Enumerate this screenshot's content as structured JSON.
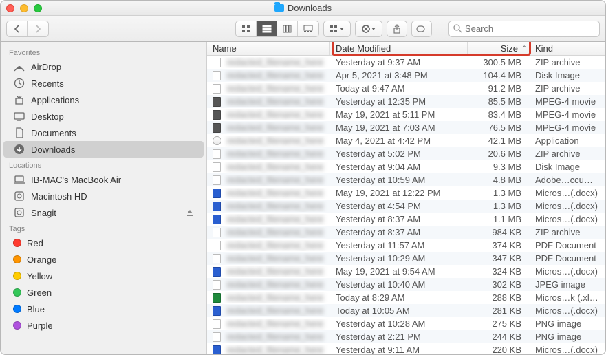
{
  "window": {
    "title": "Downloads"
  },
  "toolbar": {
    "search_placeholder": "Search"
  },
  "sidebar": {
    "sections": [
      {
        "header": "Favorites",
        "items": [
          {
            "icon": "airdrop",
            "label": "AirDrop"
          },
          {
            "icon": "clock",
            "label": "Recents"
          },
          {
            "icon": "apps",
            "label": "Applications"
          },
          {
            "icon": "desktop",
            "label": "Desktop"
          },
          {
            "icon": "doc",
            "label": "Documents"
          },
          {
            "icon": "download",
            "label": "Downloads",
            "selected": true
          }
        ]
      },
      {
        "header": "Locations",
        "items": [
          {
            "icon": "laptop",
            "label": "IB-MAC's MacBook Air"
          },
          {
            "icon": "disk",
            "label": "Macintosh HD"
          },
          {
            "icon": "disk",
            "label": "Snagit",
            "eject": true
          }
        ]
      },
      {
        "header": "Tags",
        "items": [
          {
            "icon": "tag",
            "color": "#ff3b30",
            "label": "Red"
          },
          {
            "icon": "tag",
            "color": "#ff9500",
            "label": "Orange"
          },
          {
            "icon": "tag",
            "color": "#ffcc00",
            "label": "Yellow"
          },
          {
            "icon": "tag",
            "color": "#34c759",
            "label": "Green"
          },
          {
            "icon": "tag",
            "color": "#007aff",
            "label": "Blue"
          },
          {
            "icon": "tag",
            "color": "#af52de",
            "label": "Purple"
          }
        ]
      }
    ]
  },
  "columns": {
    "name": "Name",
    "date": "Date Modified",
    "size": "Size",
    "kind": "Kind"
  },
  "files": [
    {
      "icon": "doc",
      "date": "Yesterday at 9:37 AM",
      "size": "300.5 MB",
      "kind": "ZIP archive"
    },
    {
      "icon": "box",
      "date": "Apr 5, 2021 at 3:48 PM",
      "size": "104.4 MB",
      "kind": "Disk Image"
    },
    {
      "icon": "doc",
      "date": "Today at 9:47 AM",
      "size": "91.2 MB",
      "kind": "ZIP archive"
    },
    {
      "icon": "dark",
      "date": "Yesterday at 12:35 PM",
      "size": "85.5 MB",
      "kind": "MPEG-4 movie"
    },
    {
      "icon": "dark",
      "date": "May 19, 2021 at 5:11 PM",
      "size": "83.4 MB",
      "kind": "MPEG-4 movie"
    },
    {
      "icon": "dark",
      "date": "May 19, 2021 at 7:03 AM",
      "size": "76.5 MB",
      "kind": "MPEG-4 movie"
    },
    {
      "icon": "app",
      "date": "May 4, 2021 at 4:42 PM",
      "size": "42.1 MB",
      "kind": "Application"
    },
    {
      "icon": "doc",
      "date": "Yesterday at 5:02 PM",
      "size": "20.6 MB",
      "kind": "ZIP archive"
    },
    {
      "icon": "box",
      "date": "Yesterday at 9:04 AM",
      "size": "9.3 MB",
      "kind": "Disk Image"
    },
    {
      "icon": "doc",
      "date": "Yesterday at 10:59 AM",
      "size": "4.8 MB",
      "kind": "Adobe…ccument"
    },
    {
      "icon": "blue",
      "date": "May 19, 2021 at 12:22 PM",
      "size": "1.3 MB",
      "kind": "Micros…(.docx)"
    },
    {
      "icon": "blue",
      "date": "Yesterday at 4:54 PM",
      "size": "1.3 MB",
      "kind": "Micros…(.docx)"
    },
    {
      "icon": "blue",
      "date": "Yesterday at 8:37 AM",
      "size": "1.1 MB",
      "kind": "Micros…(.docx)"
    },
    {
      "icon": "doc",
      "date": "Yesterday at 8:37 AM",
      "size": "984 KB",
      "kind": "ZIP archive"
    },
    {
      "icon": "doc",
      "date": "Yesterday at 11:57 AM",
      "size": "374 KB",
      "kind": "PDF Document"
    },
    {
      "icon": "doc",
      "date": "Yesterday at 10:29 AM",
      "size": "347 KB",
      "kind": "PDF Document"
    },
    {
      "icon": "blue",
      "date": "May 19, 2021 at 9:54 AM",
      "size": "324 KB",
      "kind": "Micros…(.docx)"
    },
    {
      "icon": "doc",
      "date": "Yesterday at 10:40 AM",
      "size": "302 KB",
      "kind": "JPEG image"
    },
    {
      "icon": "green",
      "date": "Today at 8:29 AM",
      "size": "288 KB",
      "kind": "Micros…k (.xlsx)"
    },
    {
      "icon": "blue",
      "date": "Today at 10:05 AM",
      "size": "281 KB",
      "kind": "Micros…(.docx)"
    },
    {
      "icon": "doc",
      "date": "Yesterday at 10:28 AM",
      "size": "275 KB",
      "kind": "PNG image"
    },
    {
      "icon": "doc",
      "date": "Yesterday at 2:21 PM",
      "size": "244 KB",
      "kind": "PNG image"
    },
    {
      "icon": "blue",
      "date": "Yesterday at 9:11 AM",
      "size": "220 KB",
      "kind": "Micros…(.docx)"
    }
  ]
}
